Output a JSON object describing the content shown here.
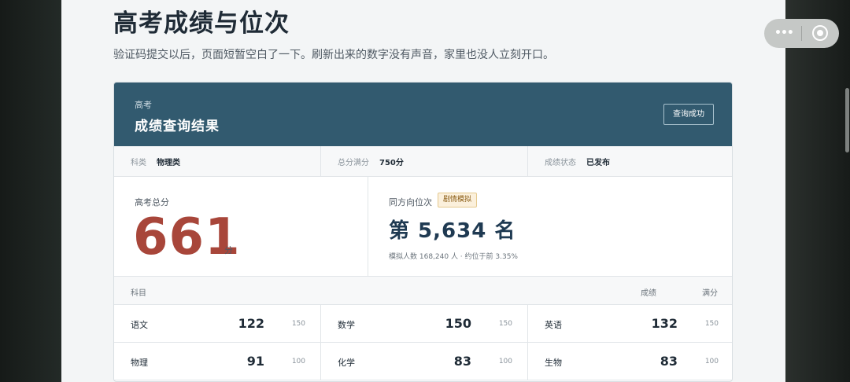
{
  "page": {
    "title": "高考成绩与位次",
    "subtitle": "验证码提交以后，页面短暂空白了一下。刷新出来的数字没有声音，家里也没人立刻开口。"
  },
  "card": {
    "header_small": "高考",
    "header_title": "成绩查询结果",
    "status_button": "查询成功",
    "info": [
      {
        "key": "科类",
        "value": "物理类"
      },
      {
        "key": "总分满分",
        "value": "750分"
      },
      {
        "key": "成绩状态",
        "value": "已发布"
      }
    ],
    "total": {
      "label": "高考总分",
      "score": "661",
      "unit": "分"
    },
    "rank": {
      "label": "同方向位次",
      "badge": "剧情模拟",
      "text": "第 5,634 名",
      "note": "模拟人数 168,240 人 · 约位于前 3.35%"
    },
    "table_head": {
      "subject": "科目",
      "score": "成绩",
      "max": "满分"
    },
    "subjects": [
      {
        "name": "语文",
        "score": "122",
        "max": "150"
      },
      {
        "name": "数学",
        "score": "150",
        "max": "150"
      },
      {
        "name": "英语",
        "score": "132",
        "max": "150"
      },
      {
        "name": "物理",
        "score": "91",
        "max": "100"
      },
      {
        "name": "化学",
        "score": "83",
        "max": "100"
      },
      {
        "name": "生物",
        "score": "83",
        "max": "100"
      }
    ]
  },
  "capsule": {
    "menu_icon": "more-dots-icon",
    "close_icon": "target-circle-icon"
  },
  "colors": {
    "header": "#325a6f",
    "score": "#a8463a",
    "rank": "#1f3a52"
  }
}
